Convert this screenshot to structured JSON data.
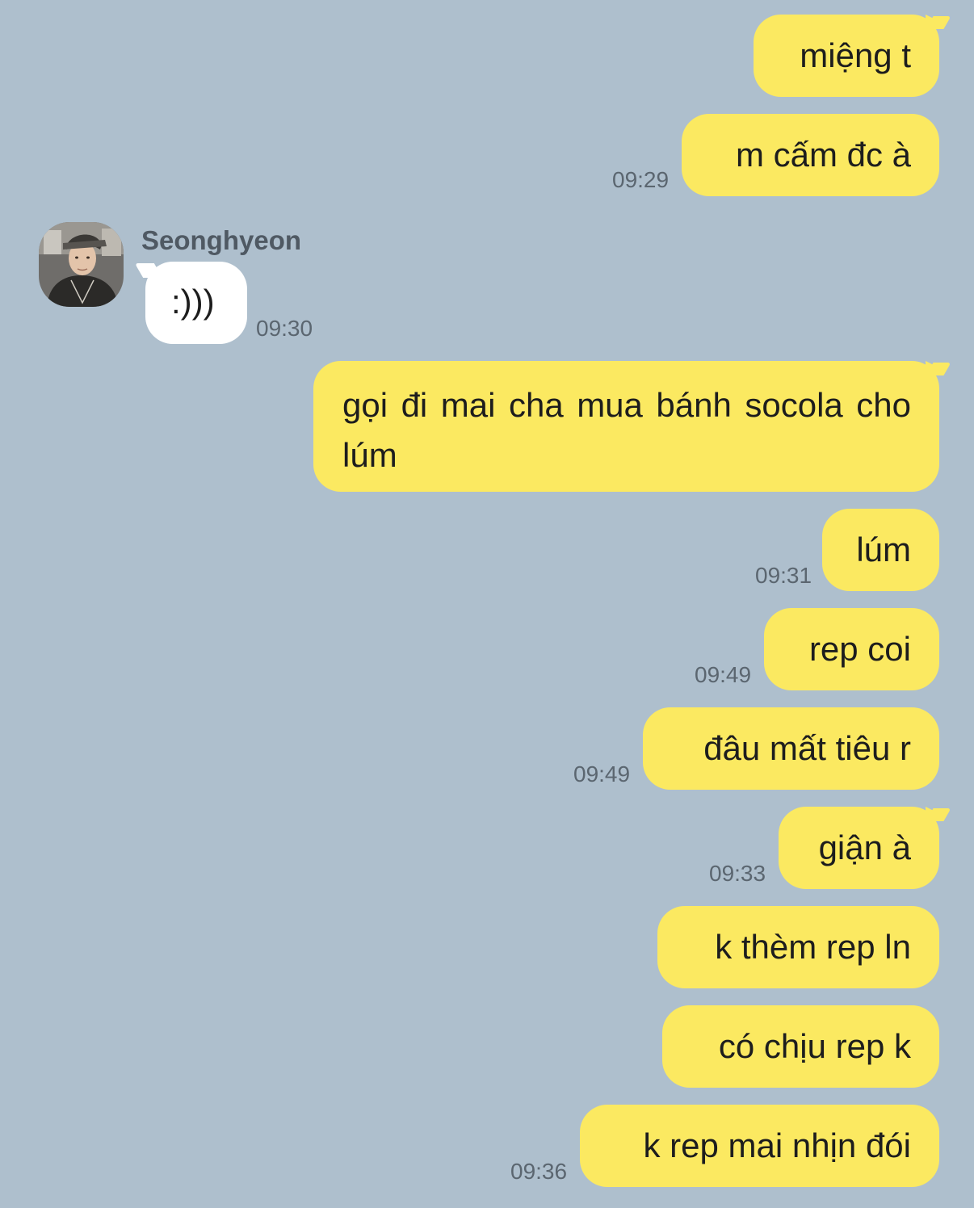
{
  "sender": {
    "name": "Seonghyeon"
  },
  "colors": {
    "background": "#aebfcd",
    "outgoing_bubble": "#fbe961",
    "incoming_bubble": "#ffffff",
    "timestamp": "#5b6670"
  },
  "messages": [
    {
      "direction": "out",
      "text": "miệng t",
      "time": ""
    },
    {
      "direction": "out",
      "text": "m cấm đc à",
      "time": "09:29"
    },
    {
      "direction": "in",
      "text": ":)))",
      "time": "09:30"
    },
    {
      "direction": "out",
      "text": "gọi đi mai cha mua bánh socola cho lúm",
      "time": ""
    },
    {
      "direction": "out",
      "text": "lúm",
      "time": "09:31"
    },
    {
      "direction": "out",
      "text": "rep coi",
      "time": "09:49"
    },
    {
      "direction": "out",
      "text": "đâu mất tiêu r",
      "time": "09:49"
    },
    {
      "direction": "out",
      "text": "giận à",
      "time": "09:33"
    },
    {
      "direction": "out",
      "text": "k thèm rep ln",
      "time": ""
    },
    {
      "direction": "out",
      "text": "có chịu rep k",
      "time": ""
    },
    {
      "direction": "out",
      "text": "k rep mai nhịn đói",
      "time": "09:36"
    }
  ]
}
